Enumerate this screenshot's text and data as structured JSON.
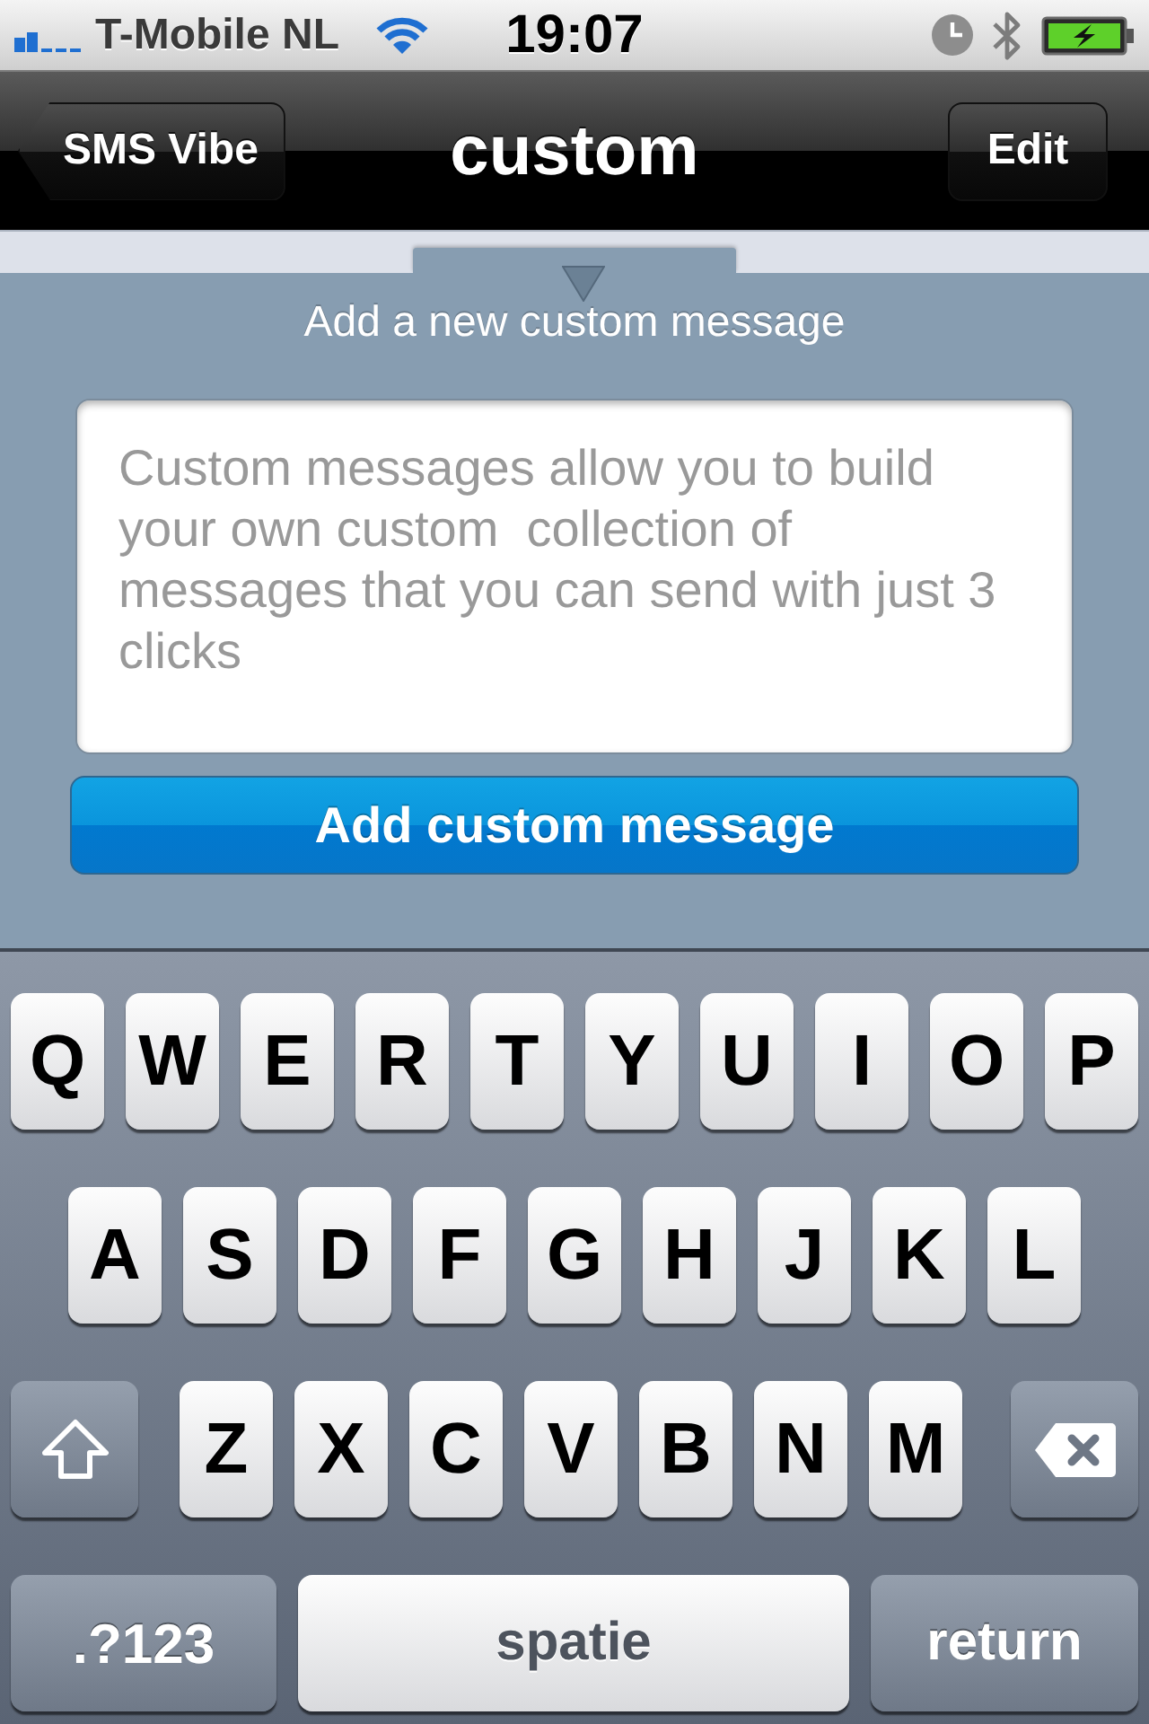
{
  "status_bar": {
    "carrier": "T-Mobile NL",
    "time": "19:07"
  },
  "nav_bar": {
    "back_button": "SMS Vibe",
    "title": "custom",
    "edit_button": "Edit"
  },
  "panel": {
    "heading": "Add a new custom message",
    "message_field": {
      "placeholder": "Custom messages allow you to build your own custom  collection of messages that you can send with just 3 clicks"
    },
    "add_button": "Add custom message"
  },
  "keyboard": {
    "top_row": [
      {
        "kind": "letter",
        "label": "Q"
      },
      {
        "kind": "letter",
        "label": "W"
      },
      {
        "kind": "letter",
        "label": "E"
      },
      {
        "kind": "letter",
        "label": "R"
      },
      {
        "kind": "letter",
        "label": "T"
      },
      {
        "kind": "letter",
        "label": "Y"
      },
      {
        "kind": "letter",
        "label": "U"
      },
      {
        "kind": "letter",
        "label": "I"
      },
      {
        "kind": "letter",
        "label": "O"
      },
      {
        "kind": "letter",
        "label": "P"
      }
    ],
    "middle_row": [
      {
        "kind": "letter",
        "label": "A"
      },
      {
        "kind": "letter",
        "label": "S"
      },
      {
        "kind": "letter",
        "label": "D"
      },
      {
        "kind": "letter",
        "label": "F"
      },
      {
        "kind": "letter",
        "label": "G"
      },
      {
        "kind": "letter",
        "label": "H"
      },
      {
        "kind": "letter",
        "label": "J"
      },
      {
        "kind": "letter",
        "label": "K"
      },
      {
        "kind": "letter",
        "label": "L"
      }
    ],
    "bottom_row": [
      {
        "kind": "shift"
      },
      {
        "kind": "letter",
        "label": "Z"
      },
      {
        "kind": "letter",
        "label": "X"
      },
      {
        "kind": "letter",
        "label": "C"
      },
      {
        "kind": "letter",
        "label": "V"
      },
      {
        "kind": "letter",
        "label": "B"
      },
      {
        "kind": "letter",
        "label": "N"
      },
      {
        "kind": "letter",
        "label": "M"
      },
      {
        "kind": "delete"
      }
    ],
    "function_keys": {
      "mode_key": ".?123",
      "space_key": "spatie",
      "return_key": "return"
    }
  }
}
